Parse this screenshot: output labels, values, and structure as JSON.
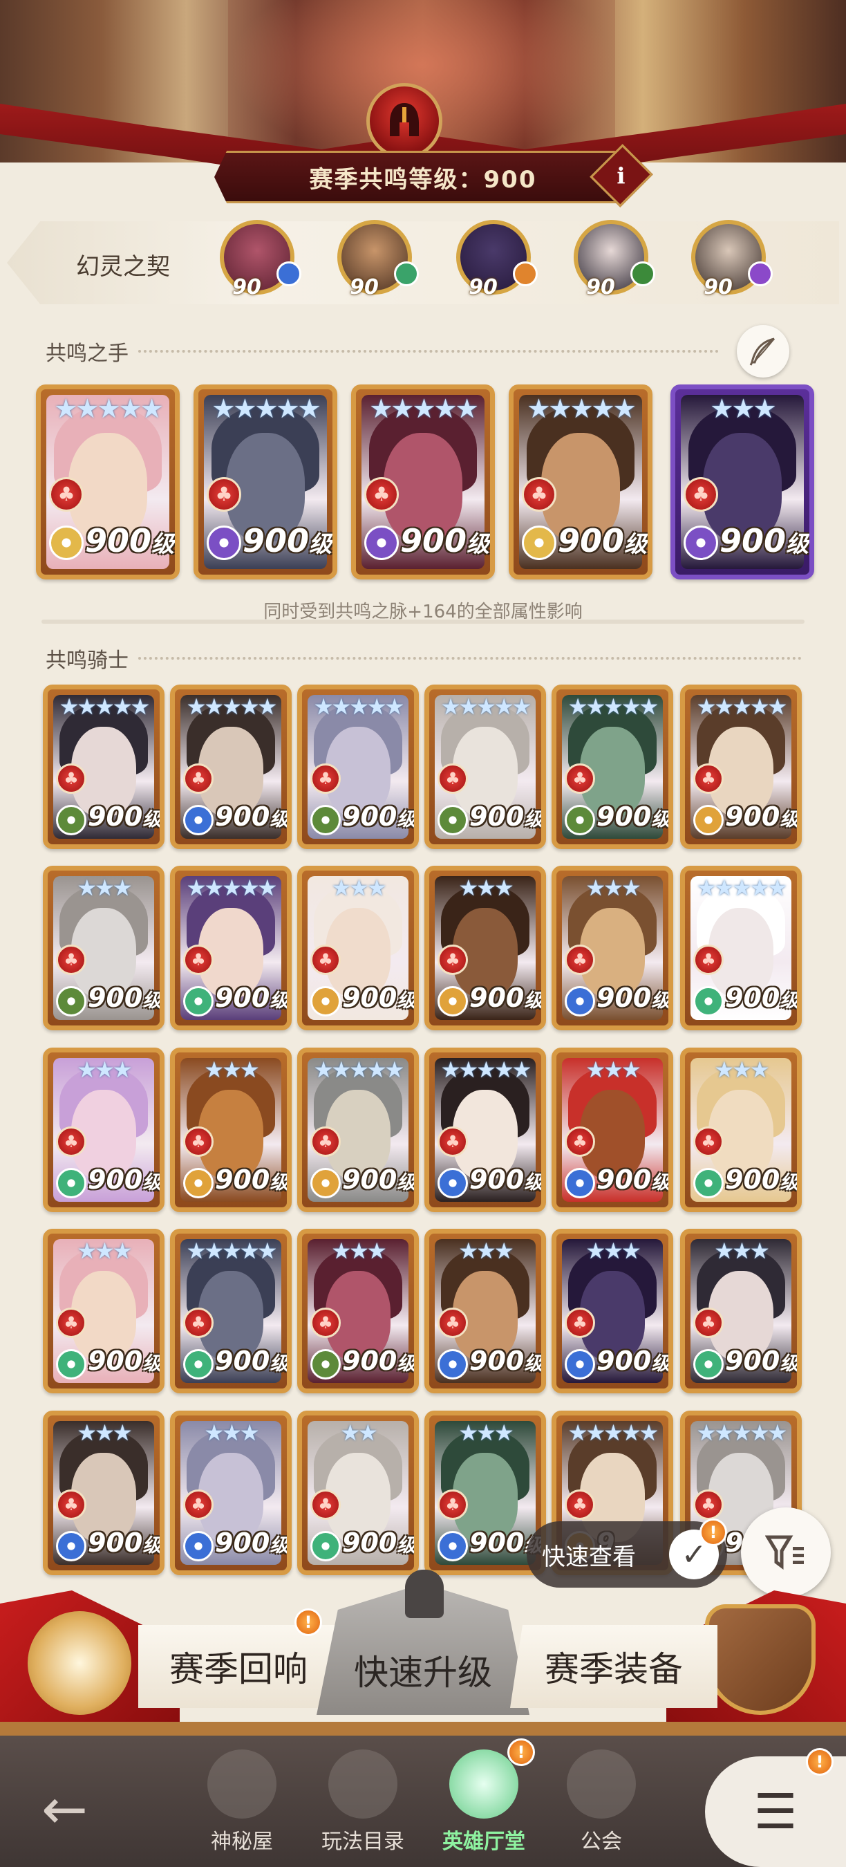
{
  "header": {
    "resonance_level_label": "赛季共鸣等级：900",
    "info_button": "i"
  },
  "contract": {
    "label": "幻灵之契",
    "avatars": [
      {
        "level": "90",
        "element_color": "#3b6fd6"
      },
      {
        "level": "90",
        "element_color": "#3aa36a"
      },
      {
        "level": "90",
        "element_color": "#e0842d"
      },
      {
        "level": "90",
        "element_color": "#3c8a3a"
      },
      {
        "level": "90",
        "element_color": "#8b49c9"
      }
    ]
  },
  "resonance_hands": {
    "title": "共鸣之手",
    "cards": [
      {
        "level": "900",
        "unit": "级",
        "stars": "★★★★★",
        "elem_color": "#e3b84a"
      },
      {
        "level": "900",
        "unit": "级",
        "stars": "★★★★★",
        "elem_color": "#7b4fc4"
      },
      {
        "level": "900",
        "unit": "级",
        "stars": "★★★★★",
        "elem_color": "#7b4fc4"
      },
      {
        "level": "900",
        "unit": "级",
        "stars": "★★★★★",
        "elem_color": "#e3b84a"
      },
      {
        "level": "900",
        "unit": "级",
        "stars": "★★★",
        "elem_color": "#7b4fc4"
      }
    ],
    "note": "同时受到共鸣之脉+164的全部属性影响"
  },
  "resonance_knights": {
    "title": "共鸣骑士",
    "rows": [
      [
        {
          "level": "900",
          "unit": "级",
          "stars": "★★★★★",
          "elem_color": "#5d8a3a"
        },
        {
          "level": "900",
          "unit": "级",
          "stars": "★★★★★",
          "elem_color": "#3b6fd6"
        },
        {
          "level": "900",
          "unit": "级",
          "stars": "★★★★★",
          "elem_color": "#5d8a3a"
        },
        {
          "level": "900",
          "unit": "级",
          "stars": "★★★★★",
          "elem_color": "#5d8a3a"
        },
        {
          "level": "900",
          "unit": "级",
          "stars": "★★★★★",
          "elem_color": "#5d8a3a"
        },
        {
          "level": "900",
          "unit": "级",
          "stars": "★★★★★",
          "elem_color": "#e0a23a"
        }
      ],
      [
        {
          "level": "900",
          "unit": "级",
          "stars": "★★★",
          "elem_color": "#5d8a3a"
        },
        {
          "level": "900",
          "unit": "级",
          "stars": "★★★★★",
          "elem_color": "#3fb27a"
        },
        {
          "level": "900",
          "unit": "级",
          "stars": "★★★",
          "elem_color": "#e0a23a"
        },
        {
          "level": "900",
          "unit": "级",
          "stars": "★★★",
          "elem_color": "#e0a23a"
        },
        {
          "level": "900",
          "unit": "级",
          "stars": "★★★",
          "elem_color": "#3b6fd6"
        },
        {
          "level": "900",
          "unit": "级",
          "stars": "★★★★★",
          "elem_color": "#3fb27a"
        }
      ],
      [
        {
          "level": "900",
          "unit": "级",
          "stars": "★★★",
          "elem_color": "#3fb27a"
        },
        {
          "level": "900",
          "unit": "级",
          "stars": "★★★",
          "elem_color": "#e0a23a"
        },
        {
          "level": "900",
          "unit": "级",
          "stars": "★★★★★",
          "elem_color": "#e0a23a"
        },
        {
          "level": "900",
          "unit": "级",
          "stars": "★★★★★",
          "elem_color": "#3b6fd6"
        },
        {
          "level": "900",
          "unit": "级",
          "stars": "★★★",
          "elem_color": "#3b6fd6"
        },
        {
          "level": "900",
          "unit": "级",
          "stars": "★★★",
          "elem_color": "#3fb27a"
        }
      ],
      [
        {
          "level": "900",
          "unit": "级",
          "stars": "★★★",
          "elem_color": "#3fb27a"
        },
        {
          "level": "900",
          "unit": "级",
          "stars": "★★★★★",
          "elem_color": "#3fb27a"
        },
        {
          "level": "900",
          "unit": "级",
          "stars": "★★★",
          "elem_color": "#5d8a3a"
        },
        {
          "level": "900",
          "unit": "级",
          "stars": "★★★",
          "elem_color": "#3b6fd6"
        },
        {
          "level": "900",
          "unit": "级",
          "stars": "★★★",
          "elem_color": "#3b6fd6"
        },
        {
          "level": "900",
          "unit": "级",
          "stars": "★★★",
          "elem_color": "#3fb27a"
        }
      ],
      [
        {
          "level": "900",
          "unit": "级",
          "stars": "★★★",
          "elem_color": "#3b6fd6"
        },
        {
          "level": "900",
          "unit": "级",
          "stars": "★★★",
          "elem_color": "#3b6fd6"
        },
        {
          "level": "900",
          "unit": "级",
          "stars": "★★",
          "elem_color": "#3fb27a"
        },
        {
          "level": "900",
          "unit": "级",
          "stars": "★★★",
          "elem_color": "#3b6fd6"
        },
        {
          "level": "9",
          "unit": "",
          "stars": "★★★★★",
          "elem_color": "#e0a23a"
        },
        {
          "level": "9",
          "unit": "",
          "stars": "★★★★★",
          "elem_color": "#e0a23a"
        }
      ]
    ]
  },
  "floating": {
    "quick_view_label": "快速查看",
    "quick_view_check": "✓",
    "quick_view_alert": "!",
    "filter_icon": "filter-icon"
  },
  "actions": {
    "season_echo": "赛季回响",
    "season_echo_alert": "!",
    "quick_upgrade": "快速升级",
    "season_gear": "赛季装备"
  },
  "nav": {
    "items": [
      {
        "label": "神秘屋",
        "active": false
      },
      {
        "label": "玩法目录",
        "active": false
      },
      {
        "label": "英雄厅堂",
        "active": true
      },
      {
        "label": "公会",
        "active": false
      }
    ],
    "hero_hall_alert": "!",
    "menu_alert": "!",
    "back_icon": "←",
    "menu_icon": "☰"
  },
  "theme": {
    "accent_red": "#9e1a1a",
    "gold": "#d79a44",
    "background": "#f1ebdf"
  }
}
